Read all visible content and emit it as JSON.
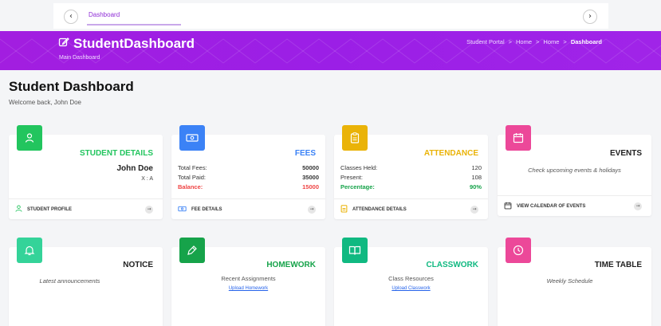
{
  "topbar": {
    "back": "‹",
    "tab_label": "Dashboard",
    "forward": "›"
  },
  "header": {
    "brand": "StudentDashboard",
    "subtitle": "Main Dashboard",
    "breadcrumbs": [
      "Student Portal",
      "Home",
      "Home",
      "Dashboard"
    ],
    "bg_color": "#9b1fe6"
  },
  "page": {
    "title": "Student Dashboard",
    "welcome": "Welcome back, John Doe"
  },
  "cards": {
    "student": {
      "title": "STUDENT DETAILS",
      "color": "#22c55e",
      "icon": "user-icon",
      "name": "John Doe",
      "class": "X : A",
      "footer": "STUDENT PROFILE"
    },
    "fees": {
      "title": "FEES",
      "color": "#3b82f6",
      "icon": "money-icon",
      "rows": [
        {
          "label": "Total Fees:",
          "value": "50000"
        },
        {
          "label": "Total Paid:",
          "value": "35000"
        },
        {
          "label": "Balance:",
          "value": "15000"
        }
      ],
      "balance_color": "#ef4444",
      "footer": "FEE DETAILS"
    },
    "attendance": {
      "title": "ATTENDANCE",
      "color": "#eab308",
      "icon": "clipboard-icon",
      "rows": [
        {
          "label": "Classes Held:",
          "value": "120"
        },
        {
          "label": "Present:",
          "value": "108"
        },
        {
          "label": "Percentage:",
          "value": "90%"
        }
      ],
      "percentage_color": "#16a34a",
      "footer": "ATTENDANCE DETAILS"
    },
    "events": {
      "title": "EVENTS",
      "color": "#ec4899",
      "icon": "calendar-icon",
      "text": "Check upcoming events & holidays",
      "footer": "VIEW CALENDAR OF EVENTS"
    },
    "notice": {
      "title": "NOTICE",
      "color": "#34d399",
      "icon": "bell-icon",
      "text": "Latest announcements"
    },
    "homework": {
      "title": "HOMEWORK",
      "color": "#16a34a",
      "icon": "pen-icon",
      "text": "Recent Assignments",
      "link": "Upload Homework"
    },
    "classwork": {
      "title": "CLASSWORK",
      "color": "#10b981",
      "icon": "book-icon",
      "text": "Class Resources",
      "link": "Upload Classwork"
    },
    "timetable": {
      "title": "TIME TABLE",
      "color": "#ec4899",
      "icon": "clock-icon",
      "text": "Weekly Schedule"
    }
  }
}
